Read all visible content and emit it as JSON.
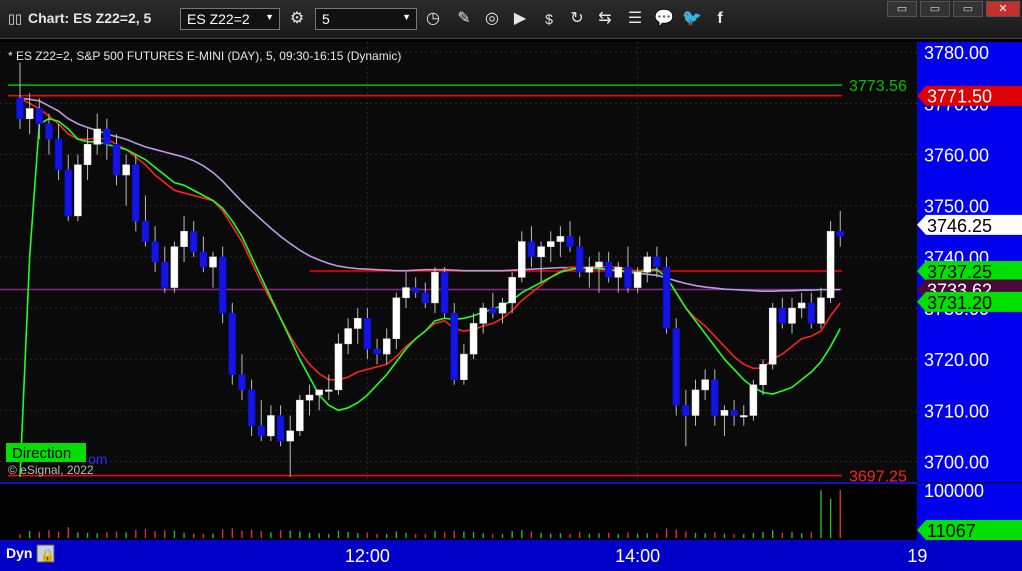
{
  "toolbar": {
    "title": "Chart: ES Z22=2, 5",
    "symbol_value": "ES Z22=2",
    "interval_value": "5",
    "icons": [
      "settings-gear-icon",
      "clock-icon",
      "draw-pencil-icon",
      "indicator-icon",
      "play-icon",
      "dollar-icon",
      "link-icon",
      "list-icon",
      "chat-icon",
      "twitter-icon",
      "facebook-icon"
    ]
  },
  "chart_header": "* ES Z22=2, S&P 500 FUTURES E-MINI (DAY), 5, 09:30-16:15 (Dynamic)",
  "watermark": "© eSignal, 2022",
  "direction_label": "Direction",
  "direction_suffix": "om",
  "footer": {
    "dyn_label": "Dyn",
    "lock_icon": "lock-icon"
  },
  "colors": {
    "up": "#ffffff",
    "down": "#1414e6",
    "ema_red": "#ff2020",
    "ema_green": "#20ff20",
    "ma_purple": "#b89ce8",
    "hline_red": "#ff0000",
    "hline_green": "#00c000"
  },
  "price_tags": [
    {
      "label": "3773.56",
      "style": "text-green",
      "price": 3773.56
    },
    {
      "label": "3771.50",
      "style": "red",
      "price": 3771.5
    },
    {
      "label": "3746.25",
      "style": "white",
      "price": 3746.25
    },
    {
      "label": "3737.25",
      "style": "green",
      "price": 3737.25
    },
    {
      "label": "3733.62",
      "style": "purple",
      "price": 3733.62
    },
    {
      "label": "3731.20",
      "style": "green",
      "price": 3731.2
    },
    {
      "label": "3697.25",
      "style": "text-red",
      "price": 3697.25
    }
  ],
  "volume_tags": [
    {
      "label": "100000",
      "style": "text-white",
      "value": 100000
    },
    {
      "label": "11067",
      "style": "green",
      "value": 11067
    }
  ],
  "chart_data": {
    "type": "candlestick",
    "y_ticks": [
      3780,
      3770,
      3760,
      3750,
      3740,
      3730,
      3720,
      3710,
      3700
    ],
    "y_tick_labels": [
      "3780.00",
      "3770.00",
      "3760.00",
      "3750.00",
      "3740.00",
      "3730.00",
      "3720.00",
      "3710.00",
      "3700.00"
    ],
    "ylim": [
      3696,
      3782
    ],
    "x_ticks": [
      {
        "label": "12:00",
        "bar": 36
      },
      {
        "label": "14:00",
        "bar": 64
      },
      {
        "label": "19",
        "bar": 93
      }
    ],
    "hlines": [
      {
        "price": 3773.56,
        "color": "#00c000"
      },
      {
        "price": 3771.5,
        "color": "#ff0000"
      },
      {
        "price": 3697.25,
        "color": "#ff0000"
      }
    ],
    "candles": [
      [
        3771,
        3778,
        3765,
        3767
      ],
      [
        3767,
        3772,
        3764,
        3769
      ],
      [
        3769,
        3771,
        3763,
        3766
      ],
      [
        3766,
        3768,
        3760,
        3763
      ],
      [
        3763,
        3766,
        3755,
        3757
      ],
      [
        3757,
        3760,
        3747,
        3748
      ],
      [
        3748,
        3760,
        3747,
        3758
      ],
      [
        3758,
        3765,
        3755,
        3762
      ],
      [
        3762,
        3768,
        3760,
        3765
      ],
      [
        3765,
        3767,
        3759,
        3762
      ],
      [
        3762,
        3764,
        3754,
        3756
      ],
      [
        3756,
        3760,
        3750,
        3758
      ],
      [
        3758,
        3760,
        3745,
        3747
      ],
      [
        3747,
        3752,
        3742,
        3743
      ],
      [
        3743,
        3746,
        3737,
        3739
      ],
      [
        3739,
        3742,
        3733,
        3734
      ],
      [
        3734,
        3743,
        3733,
        3742
      ],
      [
        3742,
        3748,
        3739,
        3745
      ],
      [
        3745,
        3747,
        3740,
        3741
      ],
      [
        3741,
        3744,
        3737,
        3738
      ],
      [
        3738,
        3741,
        3734,
        3740
      ],
      [
        3740,
        3742,
        3727,
        3729
      ],
      [
        3729,
        3731,
        3715,
        3717
      ],
      [
        3717,
        3721,
        3712,
        3714
      ],
      [
        3714,
        3716,
        3705,
        3707
      ],
      [
        3707,
        3712,
        3704,
        3705
      ],
      [
        3705,
        3711,
        3704,
        3709
      ],
      [
        3709,
        3711,
        3703,
        3704
      ],
      [
        3704,
        3709,
        3697,
        3706
      ],
      [
        3706,
        3713,
        3705,
        3712
      ],
      [
        3712,
        3715,
        3709,
        3713
      ],
      [
        3713,
        3714,
        3710,
        3714
      ],
      [
        3714,
        3717,
        3712,
        3714
      ],
      [
        3714,
        3725,
        3713,
        3723
      ],
      [
        3723,
        3728,
        3721,
        3726
      ],
      [
        3726,
        3730,
        3723,
        3728
      ],
      [
        3728,
        3730,
        3720,
        3722
      ],
      [
        3722,
        3724,
        3719,
        3721
      ],
      [
        3721,
        3726,
        3719,
        3724
      ],
      [
        3724,
        3733,
        3722,
        3732
      ],
      [
        3732,
        3737,
        3730,
        3734
      ],
      [
        3734,
        3736,
        3732,
        3733
      ],
      [
        3733,
        3735,
        3730,
        3731
      ],
      [
        3731,
        3738,
        3729,
        3737
      ],
      [
        3737,
        3738,
        3728,
        3729
      ],
      [
        3729,
        3731,
        3715,
        3716
      ],
      [
        3716,
        3723,
        3715,
        3721
      ],
      [
        3721,
        3729,
        3720,
        3727
      ],
      [
        3727,
        3731,
        3725,
        3730
      ],
      [
        3730,
        3733,
        3728,
        3729
      ],
      [
        3729,
        3732,
        3727,
        3731
      ],
      [
        3731,
        3737,
        3729,
        3736
      ],
      [
        3736,
        3745,
        3735,
        3743
      ],
      [
        3743,
        3746,
        3738,
        3740
      ],
      [
        3740,
        3743,
        3735,
        3742
      ],
      [
        3742,
        3745,
        3739,
        3743
      ],
      [
        3743,
        3746,
        3740,
        3744
      ],
      [
        3744,
        3747,
        3741,
        3742
      ],
      [
        3742,
        3744,
        3736,
        3737
      ],
      [
        3737,
        3740,
        3734,
        3738
      ],
      [
        3738,
        3741,
        3733,
        3739
      ],
      [
        3739,
        3741,
        3735,
        3736
      ],
      [
        3736,
        3739,
        3733,
        3738
      ],
      [
        3738,
        3742,
        3733,
        3734
      ],
      [
        3734,
        3738,
        3733,
        3737
      ],
      [
        3737,
        3741,
        3735,
        3740
      ],
      [
        3740,
        3742,
        3736,
        3738
      ],
      [
        3738,
        3740,
        3725,
        3726
      ],
      [
        3726,
        3728,
        3709,
        3711
      ],
      [
        3711,
        3714,
        3703,
        3709
      ],
      [
        3709,
        3716,
        3707,
        3714
      ],
      [
        3714,
        3718,
        3712,
        3716
      ],
      [
        3716,
        3718,
        3707,
        3709
      ],
      [
        3709,
        3711,
        3705,
        3710
      ],
      [
        3710,
        3712,
        3707,
        3709
      ],
      [
        3709,
        3711,
        3707,
        3709
      ],
      [
        3709,
        3716,
        3708,
        3715
      ],
      [
        3715,
        3720,
        3713,
        3719
      ],
      [
        3719,
        3731,
        3718,
        3730
      ],
      [
        3730,
        3732,
        3726,
        3727
      ],
      [
        3727,
        3732,
        3725,
        3730
      ],
      [
        3730,
        3733,
        3728,
        3731
      ],
      [
        3731,
        3733,
        3726,
        3727
      ],
      [
        3727,
        3734,
        3726,
        3732
      ],
      [
        3732,
        3747,
        3731,
        3745
      ],
      [
        3745,
        3749,
        3742,
        3744
      ]
    ],
    "ema_red": [
      3771,
      3770,
      3769,
      3767.5,
      3766,
      3764,
      3763,
      3763,
      3763.2,
      3763,
      3762,
      3761,
      3759.5,
      3758,
      3756,
      3754.5,
      3753,
      3752.5,
      3752,
      3751.5,
      3751,
      3749,
      3746,
      3743,
      3739,
      3735,
      3731.5,
      3728,
      3724.5,
      3721.5,
      3719,
      3717.2,
      3716,
      3716,
      3716.5,
      3717.5,
      3718,
      3718.5,
      3719,
      3720.5,
      3722.5,
      3724,
      3725.5,
      3727,
      3727.5,
      3726,
      3725.5,
      3725.8,
      3726.5,
      3727,
      3728,
      3729.5,
      3731.5,
      3733,
      3734.5,
      3736,
      3737.2,
      3738,
      3738,
      3738,
      3738.2,
      3738,
      3738,
      3737.5,
      3737.3,
      3737.5,
      3737.6,
      3736,
      3733,
      3730,
      3728,
      3726.5,
      3724.5,
      3722.5,
      3720.5,
      3719,
      3718.2,
      3718.3,
      3720,
      3721,
      3722.5,
      3724,
      3724.5,
      3725.5,
      3728.5,
      3731
    ],
    "ema_green": [
      3697,
      3740,
      3766,
      3767,
      3766.5,
      3765,
      3763,
      3762.5,
      3762.5,
      3762,
      3761.5,
      3761,
      3760,
      3759,
      3757.5,
      3756,
      3754.5,
      3754,
      3753,
      3752,
      3751,
      3749.5,
      3747,
      3744,
      3740,
      3736,
      3732,
      3728,
      3724,
      3720,
      3716.5,
      3713,
      3711,
      3710,
      3710.5,
      3711.5,
      3713,
      3715,
      3717,
      3719.5,
      3722,
      3724,
      3725.5,
      3727.5,
      3728,
      3727.8,
      3728,
      3728.5,
      3729.2,
      3729.8,
      3730.5,
      3731.5,
      3733,
      3734,
      3735,
      3736,
      3737,
      3737.5,
      3737.8,
      3737.8,
      3737.8,
      3737.5,
      3737.5,
      3737,
      3737,
      3737.3,
      3737.5,
      3736,
      3733,
      3730,
      3727.5,
      3725,
      3722.5,
      3720,
      3718,
      3716,
      3714.5,
      3713.5,
      3713.2,
      3713.8,
      3714.5,
      3716,
      3717.5,
      3719.5,
      3722.5,
      3726
    ],
    "ma_purple": [
      3771,
      3770.8,
      3770.5,
      3769.5,
      3768.5,
      3767,
      3766,
      3765.3,
      3764.7,
      3764,
      3763.5,
      3763,
      3762.2,
      3761.5,
      3761,
      3760.5,
      3760,
      3759.5,
      3758.8,
      3757.8,
      3756.5,
      3754.8,
      3752.8,
      3750.8,
      3749,
      3747.3,
      3745.6,
      3744,
      3742.6,
      3741.3,
      3740.2,
      3739.4,
      3738.7,
      3738.2,
      3737.9,
      3737.7,
      3737.6,
      3737.5,
      3737.4,
      3737.3,
      3737.3,
      3737.4,
      3737.5,
      3737.5,
      3737.5,
      3737.4,
      3737.3,
      3737.3,
      3737.3,
      3737.3,
      3737.3,
      3737.4,
      3737.5,
      3737.6,
      3737.7,
      3737.8,
      3737.9,
      3737.9,
      3737.9,
      3737.8,
      3737.7,
      3737.5,
      3737.3,
      3737,
      3736.8,
      3736.6,
      3736.4,
      3735.9,
      3735.3,
      3734.8,
      3734.4,
      3734.1,
      3733.9,
      3733.7,
      3733.6,
      3733.5,
      3733.4,
      3733.3,
      3733.3,
      3733.4,
      3733.4,
      3733.5,
      3733.5,
      3733.6,
      3733.6,
      3733.6
    ],
    "hline_red_mid": {
      "price": 3737.25,
      "from_bar": 30
    },
    "hline_purple": {
      "price": 3733.62
    },
    "volume": [
      900,
      1600,
      1400,
      1800,
      1500,
      2500,
      1300,
      1200,
      1100,
      1400,
      1500,
      1300,
      1900,
      2100,
      1600,
      1800,
      1700,
      1200,
      1000,
      900,
      1000,
      2000,
      2200,
      1700,
      1900,
      1600,
      1300,
      1800,
      1700,
      1500,
      1200,
      1100,
      900,
      1700,
      1400,
      1100,
      1300,
      900,
      900,
      1500,
      1200,
      900,
      900,
      1600,
      1300,
      1700,
      1500,
      1400,
      1100,
      900,
      900,
      1600,
      1800,
      1500,
      1200,
      1000,
      1100,
      900,
      1400,
      1000,
      1100,
      1200,
      900,
      1300,
      1000,
      1100,
      1000,
      2200,
      2000,
      1500,
      1200,
      1100,
      1300,
      1000,
      900,
      900,
      1200,
      1400,
      1800,
      1200,
      1300,
      1100,
      1300,
      11000,
      9000,
      11067
    ]
  }
}
